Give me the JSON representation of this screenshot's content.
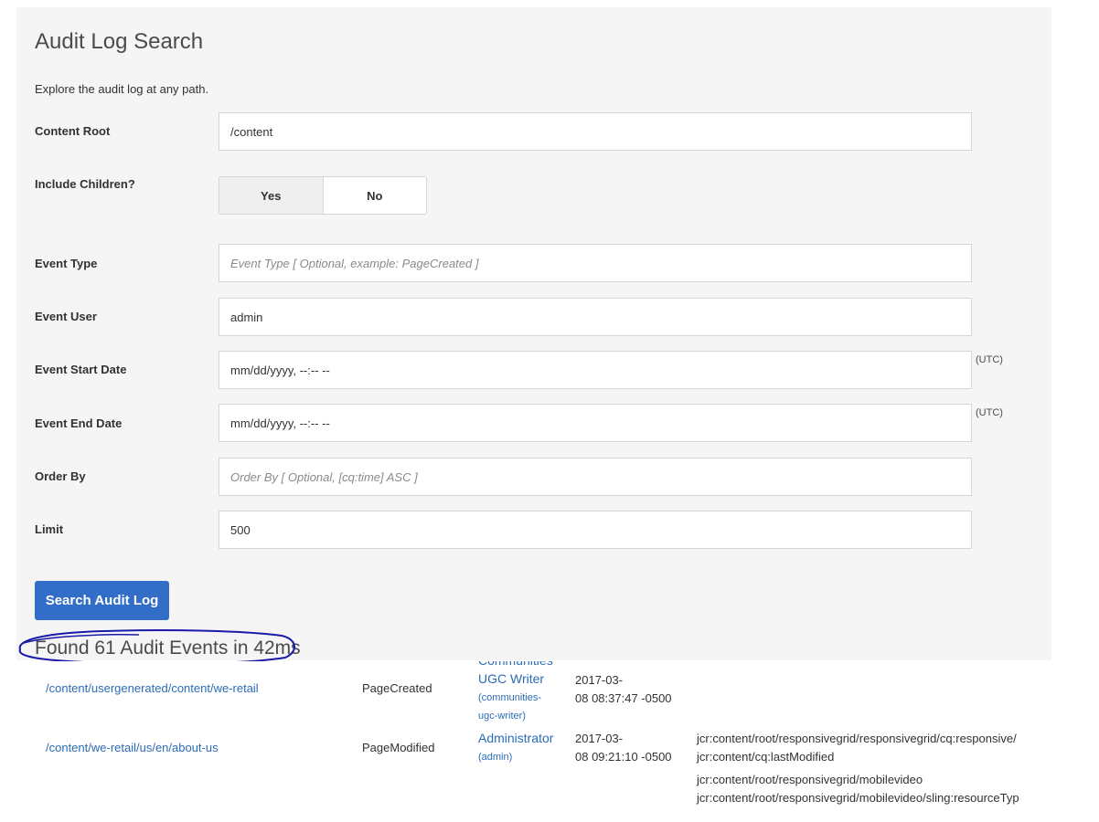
{
  "page": {
    "title": "Audit Log Search",
    "description": "Explore the audit log at any path."
  },
  "form": {
    "content_root": {
      "label": "Content Root",
      "value": "/content"
    },
    "include_children": {
      "label": "Include Children?",
      "yes": "Yes",
      "no": "No",
      "selected": "Yes"
    },
    "event_type": {
      "label": "Event Type",
      "value": "",
      "placeholder": "Event Type [ Optional, example: PageCreated ]"
    },
    "event_user": {
      "label": "Event User",
      "value": "admin"
    },
    "event_start_date": {
      "label": "Event Start Date",
      "value": "mm/dd/yyyy, --:-- --",
      "suffix": "(UTC)"
    },
    "event_end_date": {
      "label": "Event End Date",
      "value": "mm/dd/yyyy, --:-- --",
      "suffix": "(UTC)"
    },
    "order_by": {
      "label": "Order By",
      "value": "",
      "placeholder": "Order By [ Optional, [cq:time] ASC ]"
    },
    "limit": {
      "label": "Limit",
      "value": "500"
    },
    "search_button": "Search Audit Log"
  },
  "results": {
    "summary": "Found 61 Audit Events in 42ms",
    "rows": [
      {
        "path": "/content/usergenerated/content/we-retail",
        "type": "PageCreated",
        "user_name_partial": "Communities",
        "user_name": "UGC Writer",
        "user_id_line1": "(communities-",
        "user_id_line2": "ugc-writer)",
        "date_line1": "2017-03-",
        "date_line2": "08 08:37:47 -0500"
      },
      {
        "path": "/content/we-retail/us/en/about-us",
        "type": "PageModified",
        "user_name": "Administrator",
        "user_id": "(admin)",
        "date_line1": "2017-03-",
        "date_line2": "08 09:21:10 -0500",
        "changes": [
          "jcr:content/root/responsivegrid/responsivegrid/cq:responsive/",
          "jcr:content/cq:lastModified",
          "jcr:content/root/responsivegrid/mobilevideo",
          "jcr:content/root/responsivegrid/mobilevideo/sling:resourceTyp"
        ]
      }
    ]
  },
  "colors": {
    "panel_bg": "#f5f5f5",
    "primary_button": "#326ec8",
    "link": "#2b6cb7",
    "annotation_ink": "#1a1aa8"
  }
}
